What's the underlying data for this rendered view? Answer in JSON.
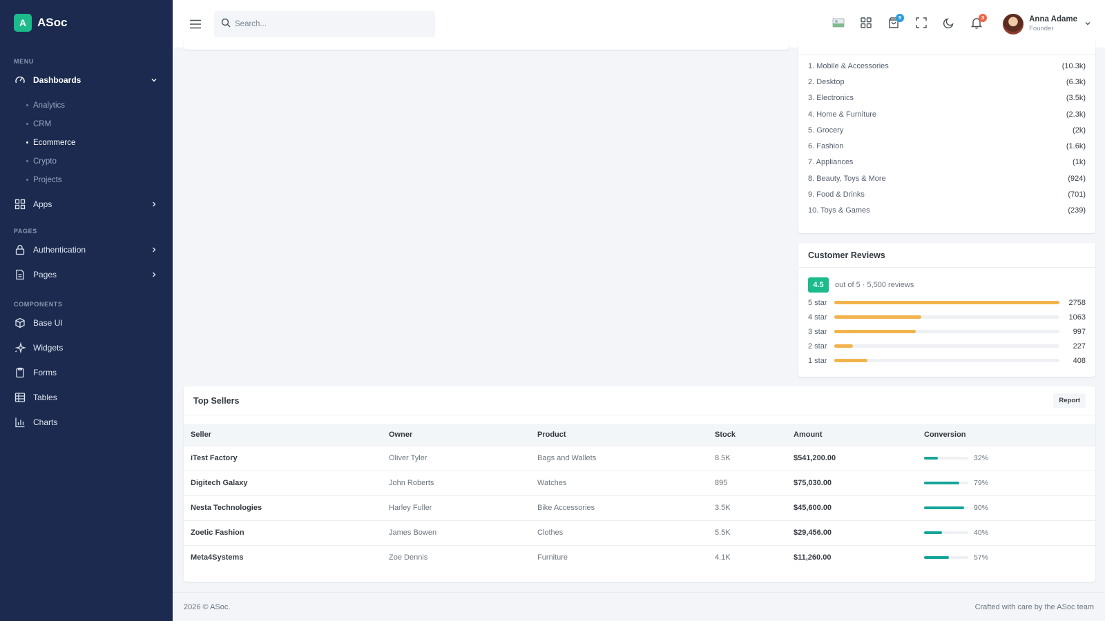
{
  "brand": {
    "logo_letter": "A",
    "name": "ASoc",
    "accent": "#1cbb8c"
  },
  "sidebar": {
    "sections": {
      "menu": "MENU",
      "pages": "PAGES",
      "components": "COMPONENTS"
    },
    "dashboards": {
      "label": "Dashboards",
      "sub": [
        "Analytics",
        "CRM",
        "Ecommerce",
        "Crypto",
        "Projects"
      ],
      "active_sub": "Ecommerce"
    },
    "apps": "Apps",
    "authentication": "Authentication",
    "pages": "Pages",
    "base_ui": "Base UI",
    "widgets": "Widgets",
    "forms": "Forms",
    "tables": "Tables",
    "charts": "Charts"
  },
  "topbar": {
    "search_placeholder": "Search...",
    "cart_badge": "5",
    "notifications_badge": "3",
    "user": {
      "name": "Anna Adame",
      "role": "Founder"
    }
  },
  "top_categories": [
    {
      "name": "1. Mobile & Accessories",
      "count": "(10.3k)"
    },
    {
      "name": "2. Desktop",
      "count": "(6.3k)"
    },
    {
      "name": "3. Electronics",
      "count": "(3.5k)"
    },
    {
      "name": "4. Home & Furniture",
      "count": "(2.3k)"
    },
    {
      "name": "5. Grocery",
      "count": "(2k)"
    },
    {
      "name": "6. Fashion",
      "count": "(1.6k)"
    },
    {
      "name": "7. Appliances",
      "count": "(1k)"
    },
    {
      "name": "8. Beauty, Toys & More",
      "count": "(924)"
    },
    {
      "name": "9. Food & Drinks",
      "count": "(701)"
    },
    {
      "name": "10. Toys & Games",
      "count": "(239)"
    }
  ],
  "reviews": {
    "title": "Customer Reviews",
    "rating": "4.5",
    "summary": "out of 5 · 5,500 reviews",
    "bar_color": "#f1b44c",
    "stars": [
      {
        "label": "5 star",
        "count": "2758",
        "fraction": 1.0
      },
      {
        "label": "4 star",
        "count": "1063",
        "fraction": 0.385
      },
      {
        "label": "3 star",
        "count": "997",
        "fraction": 0.362
      },
      {
        "label": "2 star",
        "count": "227",
        "fraction": 0.082
      },
      {
        "label": "1 star",
        "count": "408",
        "fraction": 0.148
      }
    ]
  },
  "top_sellers": {
    "title": "Top Sellers",
    "report_label": "Report",
    "columns": [
      "Seller",
      "Owner",
      "Product",
      "Stock",
      "Amount",
      "Conversion"
    ],
    "rows": [
      {
        "seller": "iTest Factory",
        "owner": "Oliver Tyler",
        "product": "Bags and Wallets",
        "stock": "8.5K",
        "amount": "$541,200.00",
        "conversion": "32%",
        "conv_value": 32
      },
      {
        "seller": "Digitech Galaxy",
        "owner": "John Roberts",
        "product": "Watches",
        "stock": "895",
        "amount": "$75,030.00",
        "conversion": "79%",
        "conv_value": 79
      },
      {
        "seller": "Nesta Technologies",
        "owner": "Harley Fuller",
        "product": "Bike Accessories",
        "stock": "3.5K",
        "amount": "$45,600.00",
        "conversion": "90%",
        "conv_value": 90
      },
      {
        "seller": "Zoetic Fashion",
        "owner": "James Bowen",
        "product": "Clothes",
        "stock": "5.5K",
        "amount": "$29,456.00",
        "conversion": "40%",
        "conv_value": 40
      },
      {
        "seller": "Meta4Systems",
        "owner": "Zoe Dennis",
        "product": "Furniture",
        "stock": "4.1K",
        "amount": "$11,260.00",
        "conversion": "57%",
        "conv_value": 57
      }
    ]
  },
  "footer": {
    "left": "2026 © ASoc.",
    "right": "Crafted with care by the ASoc team"
  }
}
